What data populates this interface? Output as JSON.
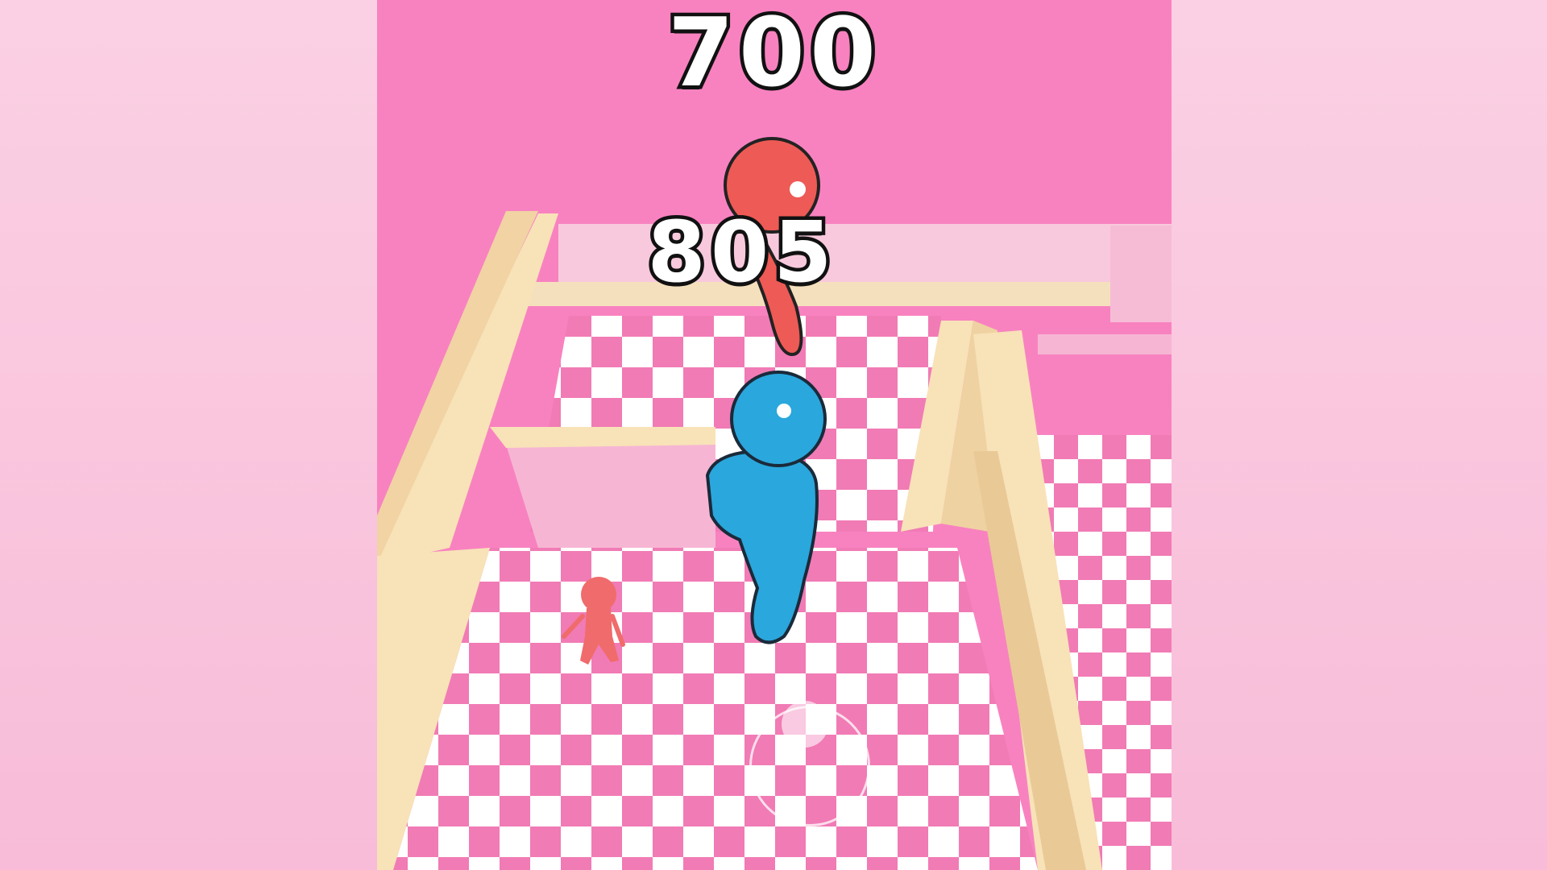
{
  "hud": {
    "score_top": "700",
    "score_player": "805"
  },
  "colors": {
    "background_pink": "#f9c4dc",
    "wall_pink": "#f882c0",
    "floor_pink_tile": "#f17bb5",
    "floor_white_tile": "#ffffff",
    "maze_wall_cream": "#f8e2b8",
    "player_blue": "#2aa7dc",
    "enemy_red": "#ee5a55"
  },
  "icons": {
    "player": "blue-stickman",
    "enemy_large": "red-stickman",
    "enemy_small": "small-red-stickman",
    "joystick": "virtual-joystick"
  }
}
